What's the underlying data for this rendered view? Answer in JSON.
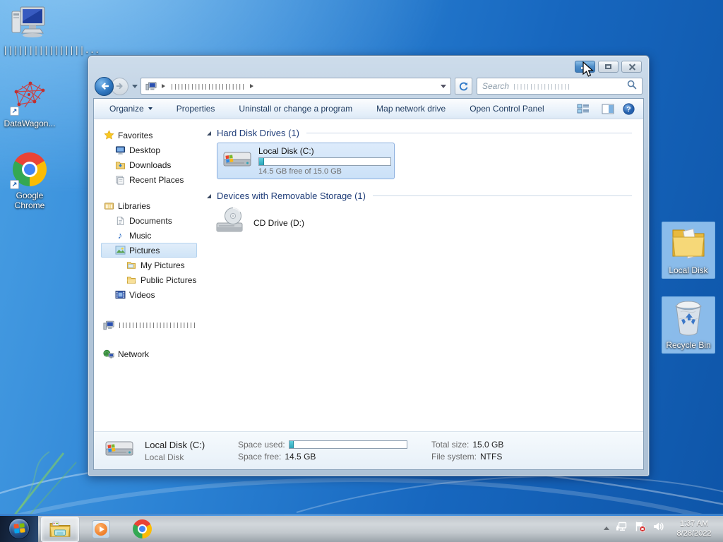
{
  "desktop_icons": [
    {
      "label": "||||||||||||||||...",
      "name": "computer-shortcut-redacted"
    },
    {
      "label": "DataWagon...",
      "name": "datawagon-shortcut"
    },
    {
      "label": "Google Chrome",
      "name": "google-chrome-shortcut"
    },
    {
      "label": "Local Disk",
      "name": "local-disk-folder"
    },
    {
      "label": "Recycle Bin",
      "name": "recycle-bin"
    }
  ],
  "explorer": {
    "address": {
      "location_redacted": "||||||||||||||||||||||"
    },
    "search": {
      "label": "Search",
      "query_redacted": "|||||||||||||||||"
    },
    "toolbar": {
      "items": [
        "Organize",
        "Properties",
        "Uninstall or change a program",
        "Map network drive",
        "Open Control Panel"
      ]
    },
    "sidebar": {
      "items": [
        {
          "label": "Favorites"
        },
        {
          "label": "Desktop"
        },
        {
          "label": "Downloads"
        },
        {
          "label": "Recent Places"
        },
        {
          "label": "Libraries"
        },
        {
          "label": "Documents"
        },
        {
          "label": "Music"
        },
        {
          "label": "Pictures"
        },
        {
          "label": "My Pictures"
        },
        {
          "label": "Public Pictures"
        },
        {
          "label": "Videos"
        },
        {
          "label": "|||||||||||||||||||||||"
        },
        {
          "label": "Network"
        }
      ]
    },
    "groups": [
      {
        "title": "Hard Disk Drives (1)"
      },
      {
        "title": "Devices with Removable Storage (1)"
      }
    ],
    "drive_c": {
      "name": "Local Disk (C:)",
      "free": "14.5 GB free of 15.0 GB",
      "used_percent": 4
    },
    "cd_d": {
      "name": "CD Drive (D:)"
    },
    "details": {
      "name": "Local Disk (C:)",
      "type": "Local Disk",
      "space_used_label": "Space used:",
      "space_free_label": "Space free:",
      "space_free_value": "14.5 GB",
      "total_label": "Total size:",
      "total_value": "15.0 GB",
      "fs_label": "File system:",
      "fs_value": "NTFS"
    }
  },
  "taskbar": {
    "time": "1:37 AM",
    "date": "8/28/2022"
  },
  "colors": {
    "progress_fill": "#2da4b8",
    "selection": "#cfe4f7",
    "taskbar_accent": "#2f7fd6"
  }
}
